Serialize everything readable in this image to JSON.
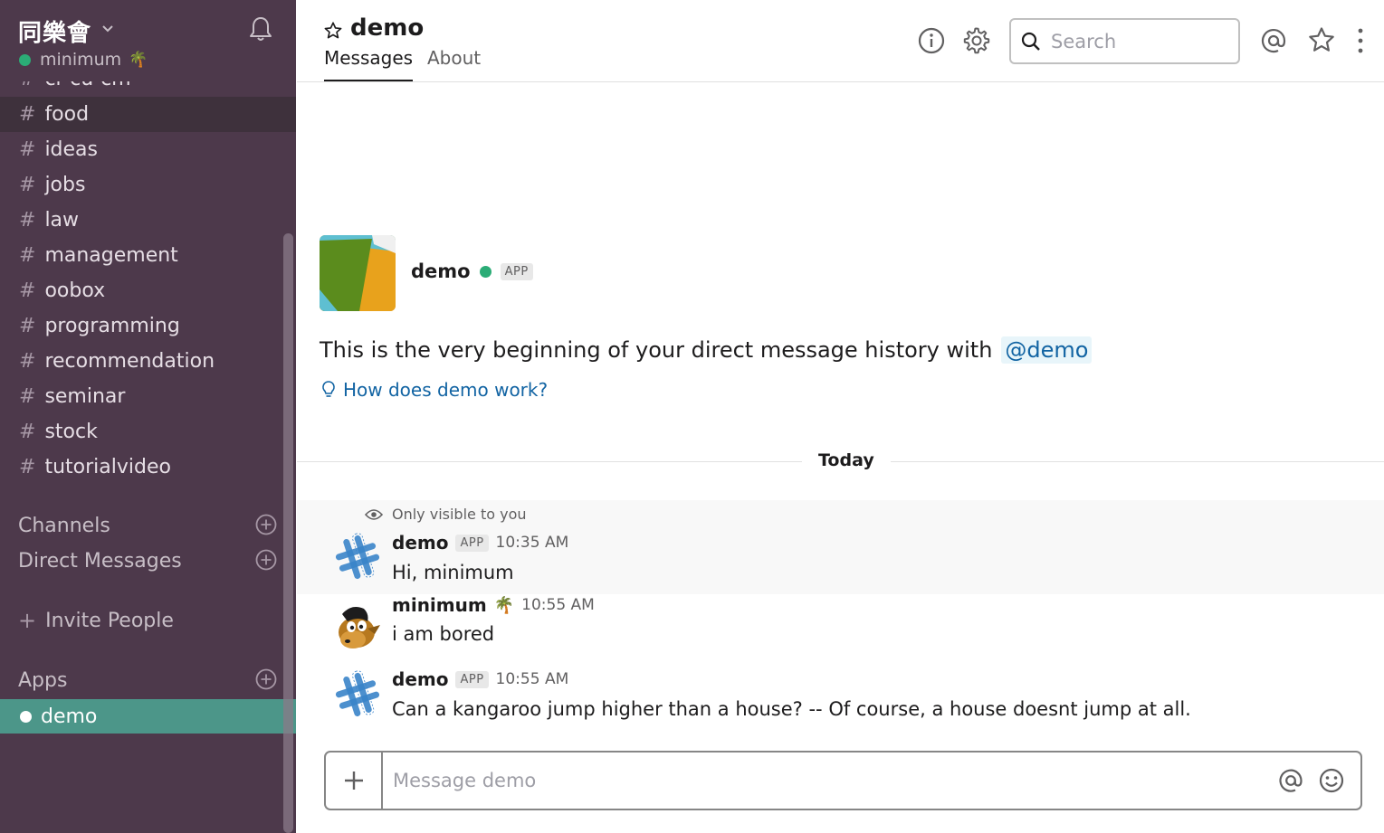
{
  "sidebar": {
    "team_name": "同樂會",
    "user_name": "minimum",
    "user_emoji": "🌴",
    "channels": [
      {
        "name": "cr-cu-cm",
        "active": false
      },
      {
        "name": "food",
        "active": true
      },
      {
        "name": "ideas",
        "active": false
      },
      {
        "name": "jobs",
        "active": false
      },
      {
        "name": "law",
        "active": false
      },
      {
        "name": "management",
        "active": false
      },
      {
        "name": "oobox",
        "active": false
      },
      {
        "name": "programming",
        "active": false
      },
      {
        "name": "recommendation",
        "active": false
      },
      {
        "name": "seminar",
        "active": false
      },
      {
        "name": "stock",
        "active": false
      },
      {
        "name": "tutorialvideo",
        "active": false
      }
    ],
    "hash": "#",
    "channels_label": "Channels",
    "dm_label": "Direct Messages",
    "invite_label": "Invite People",
    "invite_plus": "+",
    "apps_label": "Apps",
    "active_app": "demo"
  },
  "header": {
    "title": "demo",
    "tabs": [
      {
        "label": "Messages",
        "active": true
      },
      {
        "label": "About",
        "active": false
      }
    ],
    "search_placeholder": "Search"
  },
  "intro": {
    "app_name": "demo",
    "badge": "APP",
    "text": "This is the very beginning of your direct message history with",
    "mention": "@demo",
    "help_link": "How does demo work?"
  },
  "day_divider": "Today",
  "ephemeral_note": "Only visible to you",
  "messages": [
    {
      "author": "demo",
      "badge": "APP",
      "time": "10:35 AM",
      "text": "Hi, minimum"
    },
    {
      "author": "minimum",
      "emoji": "🌴",
      "time": "10:55 AM",
      "text": "i am bored"
    },
    {
      "author": "demo",
      "badge": "APP",
      "time": "10:55 AM",
      "text": "Can a kangaroo jump higher than a house? -- Of course, a house doesnt jump at all."
    }
  ],
  "composer": {
    "placeholder": "Message demo"
  },
  "colors": {
    "sidebar_bg": "#4d394b",
    "active_channel_bg": "#3e313c",
    "active_app_bg": "#4c9689",
    "presence_green": "#2bac76",
    "link_blue": "#1264a3"
  }
}
